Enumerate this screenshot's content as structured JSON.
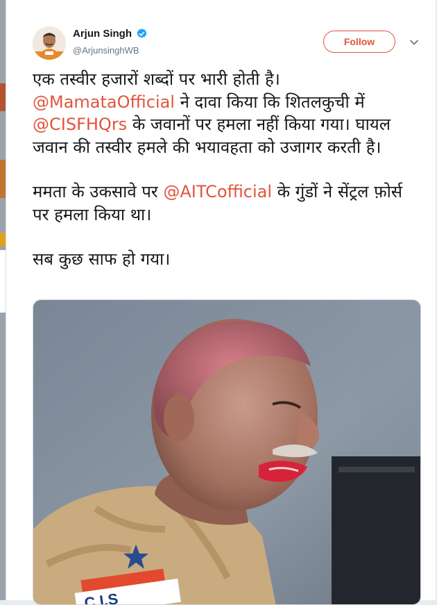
{
  "tweet": {
    "author": {
      "display_name": "Arjun Singh",
      "handle": "@ArjunsinghWB",
      "verified": true
    },
    "follow_label": "Follow",
    "paragraphs": [
      [
        {
          "text": "एक तस्वीर हजारों शब्दों पर भारी होती है।",
          "type": "text"
        },
        {
          "text": "\n",
          "type": "br"
        },
        {
          "text": "@MamataOfficial",
          "type": "mention"
        },
        {
          "text": " ने दावा किया कि शितलकुची में",
          "type": "text"
        },
        {
          "text": "\n",
          "type": "br"
        },
        {
          "text": "@CISFHQrs",
          "type": "mention"
        },
        {
          "text": " के जवानों पर हमला नहीं किया गया। घायल जवान की तस्वीर हमले की भयावहता को उजागर करती है।",
          "type": "text"
        }
      ],
      [
        {
          "text": "ममता के उकसावे पर ",
          "type": "text"
        },
        {
          "text": "@AITCofficial",
          "type": "mention"
        },
        {
          "text": " के गुंडों ने सेंट्रल फ़ोर्स पर हमला किया था।",
          "type": "text"
        }
      ],
      [
        {
          "text": "सब कुछ साफ हो गया।",
          "type": "text"
        }
      ]
    ],
    "media": {
      "badge_text": "C.I.S"
    }
  },
  "colors": {
    "accent": "#e2543c",
    "verified": "#1da1f2",
    "text": "#14171a",
    "secondary": "#657786"
  },
  "icons": {
    "verified": "verified-badge-icon",
    "menu": "chevron-down-icon"
  }
}
